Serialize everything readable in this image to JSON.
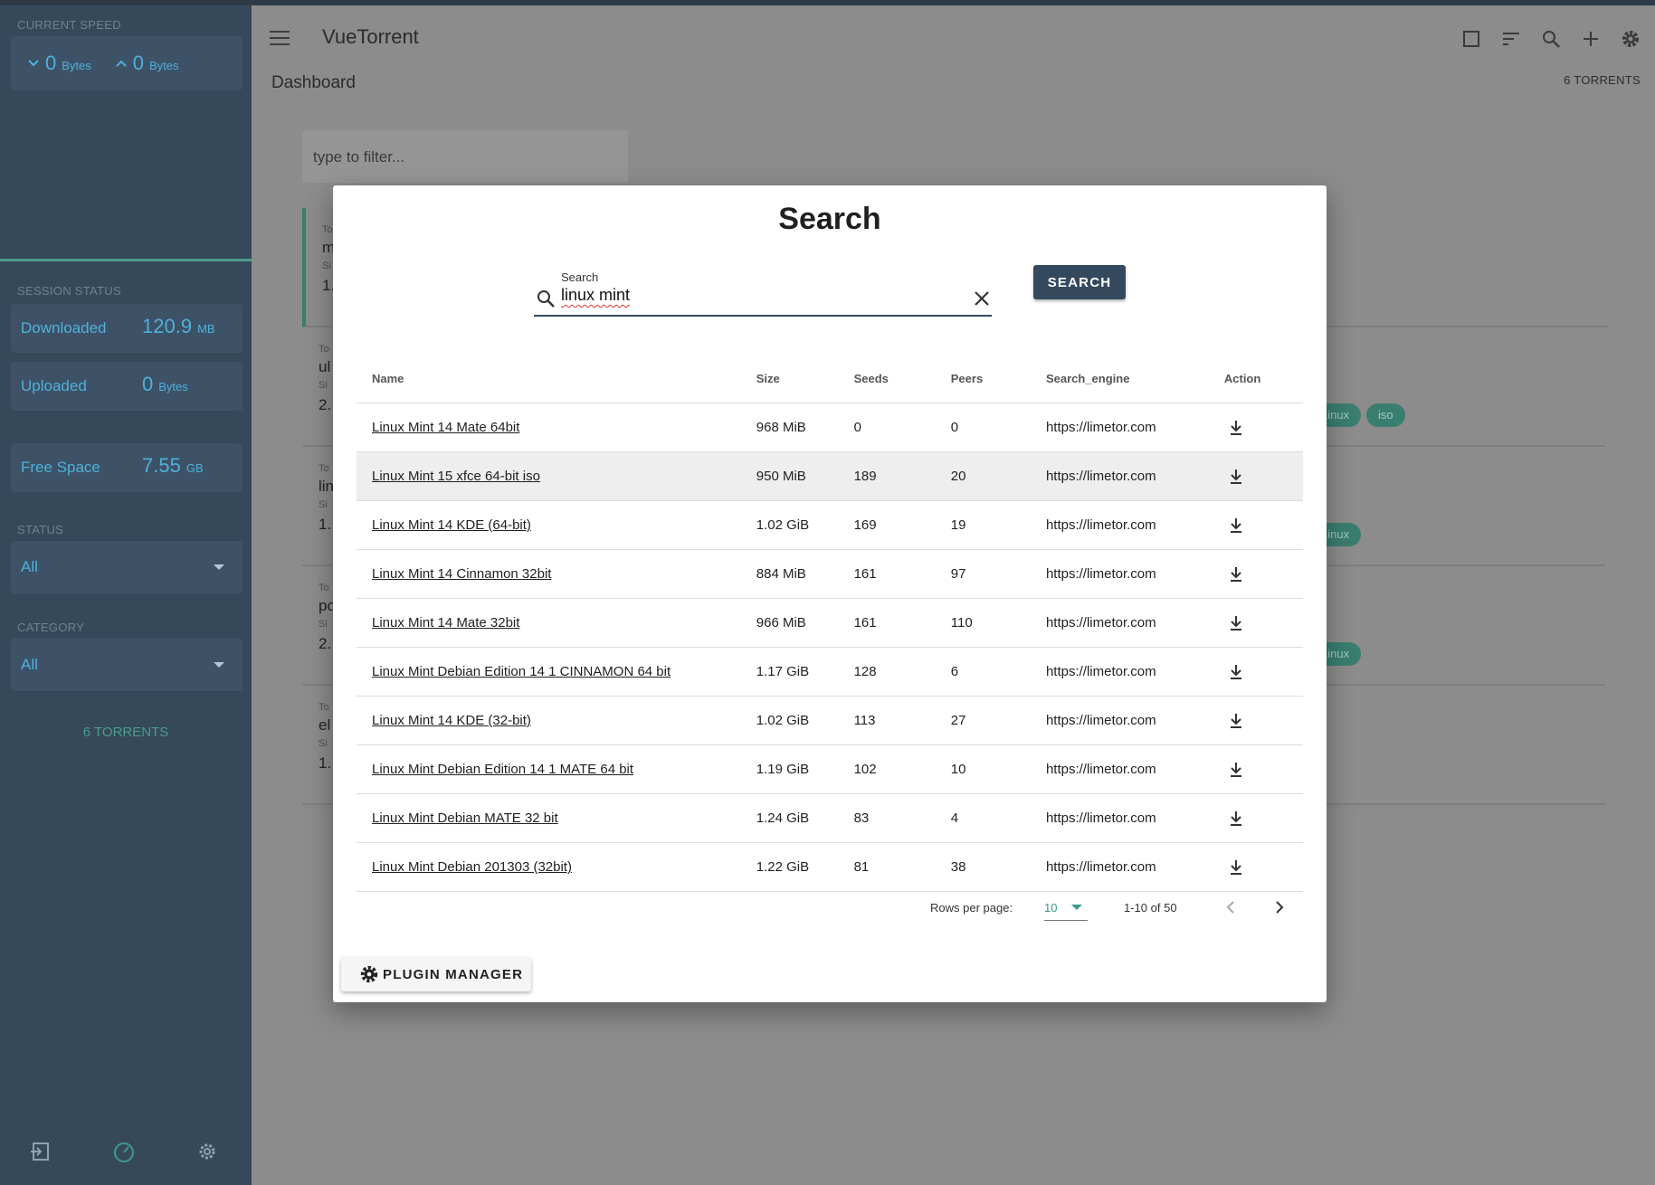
{
  "app": {
    "title": "VueTorrent"
  },
  "sidebar": {
    "current_speed_label": "CURRENT SPEED",
    "download_speed": {
      "value": "0",
      "unit": "Bytes"
    },
    "upload_speed": {
      "value": "0",
      "unit": "Bytes"
    },
    "session_status_label": "SESSION STATUS",
    "downloaded": {
      "label": "Downloaded",
      "value": "120.9",
      "unit": "MB"
    },
    "uploaded": {
      "label": "Uploaded",
      "value": "0",
      "unit": "Bytes"
    },
    "free_space": {
      "label": "Free Space",
      "value": "7.55",
      "unit": "GB"
    },
    "status_label": "STATUS",
    "status_value": "All",
    "category_label": "CATEGORY",
    "category_value": "All",
    "torrent_count": "6 TORRENTS"
  },
  "header": {
    "breadcrumb": "Dashboard",
    "torrent_count": "6 TORRENTS",
    "filter_placeholder": "type to filter..."
  },
  "background_torrents": [
    {
      "l1": "To",
      "l2": "m",
      "l3": "Si",
      "l4": "1."
    },
    {
      "l1": "To",
      "l2": "ul",
      "l3": "Si",
      "l4": "2."
    },
    {
      "l1": "To",
      "l2": "lin",
      "l3": "Si",
      "l4": "1."
    },
    {
      "l1": "To",
      "l2": "po",
      "l3": "Si",
      "l4": "2."
    },
    {
      "l1": "To",
      "l2": "el",
      "l3": "Si",
      "l4": "1."
    }
  ],
  "background_tags": [
    "Linux",
    "iso",
    "Linux",
    "Linux"
  ],
  "modal": {
    "title": "Search",
    "search_label": "Search",
    "search_value": "linux mint",
    "search_button": "SEARCH",
    "columns": [
      "Name",
      "Size",
      "Seeds",
      "Peers",
      "Search_engine",
      "Action"
    ],
    "rows": [
      {
        "name": "Linux Mint 14 Mate 64bit",
        "size": "968 MiB",
        "seeds": "0",
        "peers": "0",
        "engine": "https://limetor.com"
      },
      {
        "name": "Linux Mint 15 xfce 64-bit iso",
        "size": "950 MiB",
        "seeds": "189",
        "peers": "20",
        "engine": "https://limetor.com"
      },
      {
        "name": "Linux Mint 14 KDE (64-bit)",
        "size": "1.02 GiB",
        "seeds": "169",
        "peers": "19",
        "engine": "https://limetor.com"
      },
      {
        "name": "Linux Mint 14 Cinnamon 32bit",
        "size": "884 MiB",
        "seeds": "161",
        "peers": "97",
        "engine": "https://limetor.com"
      },
      {
        "name": "Linux Mint 14 Mate 32bit",
        "size": "966 MiB",
        "seeds": "161",
        "peers": "110",
        "engine": "https://limetor.com"
      },
      {
        "name": "Linux Mint Debian Edition 14 1 CINNAMON 64 bit",
        "size": "1.17 GiB",
        "seeds": "128",
        "peers": "6",
        "engine": "https://limetor.com"
      },
      {
        "name": "Linux Mint 14 KDE (32-bit)",
        "size": "1.02 GiB",
        "seeds": "113",
        "peers": "27",
        "engine": "https://limetor.com"
      },
      {
        "name": "Linux Mint Debian Edition 14 1 MATE 64 bit",
        "size": "1.19 GiB",
        "seeds": "102",
        "peers": "10",
        "engine": "https://limetor.com"
      },
      {
        "name": "Linux Mint Debian MATE 32 bit",
        "size": "1.24 GiB",
        "seeds": "83",
        "peers": "4",
        "engine": "https://limetor.com"
      },
      {
        "name": "Linux Mint Debian 201303 (32bit)",
        "size": "1.22 GiB",
        "seeds": "81",
        "peers": "38",
        "engine": "https://limetor.com"
      }
    ],
    "highlighted_row": 1,
    "pagination": {
      "rows_per_page_label": "Rows per page:",
      "rows_per_page": "10",
      "range": "1-10 of 50"
    },
    "plugin_manager_button": "PLUGIN MANAGER"
  }
}
